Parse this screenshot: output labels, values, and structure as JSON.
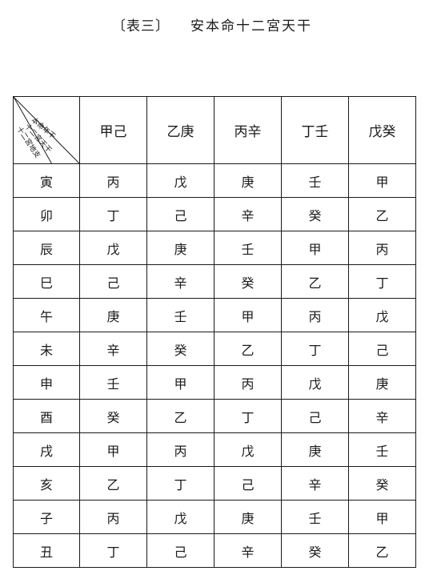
{
  "title": {
    "label": "〔表三〕",
    "text": "安本命十二宮天干"
  },
  "corner": {
    "top_label": "本命年干",
    "mid_label": "十二宮天干",
    "bottom_label": "十二宮地支"
  },
  "columns": [
    "甲己",
    "乙庚",
    "丙辛",
    "丁壬",
    "戊癸"
  ],
  "rows": [
    {
      "branch": "寅",
      "cells": [
        "丙",
        "戊",
        "庚",
        "壬",
        "甲"
      ]
    },
    {
      "branch": "卯",
      "cells": [
        "丁",
        "己",
        "辛",
        "癸",
        "乙"
      ]
    },
    {
      "branch": "辰",
      "cells": [
        "戊",
        "庚",
        "壬",
        "甲",
        "丙"
      ]
    },
    {
      "branch": "巳",
      "cells": [
        "己",
        "辛",
        "癸",
        "乙",
        "丁"
      ]
    },
    {
      "branch": "午",
      "cells": [
        "庚",
        "壬",
        "甲",
        "丙",
        "戊"
      ]
    },
    {
      "branch": "未",
      "cells": [
        "辛",
        "癸",
        "乙",
        "丁",
        "己"
      ]
    },
    {
      "branch": "申",
      "cells": [
        "壬",
        "甲",
        "丙",
        "戊",
        "庚"
      ]
    },
    {
      "branch": "酉",
      "cells": [
        "癸",
        "乙",
        "丁",
        "己",
        "辛"
      ]
    },
    {
      "branch": "戌",
      "cells": [
        "甲",
        "丙",
        "戊",
        "庚",
        "壬"
      ]
    },
    {
      "branch": "亥",
      "cells": [
        "乙",
        "丁",
        "己",
        "辛",
        "癸"
      ]
    },
    {
      "branch": "子",
      "cells": [
        "丙",
        "戊",
        "庚",
        "壬",
        "甲"
      ]
    },
    {
      "branch": "丑",
      "cells": [
        "丁",
        "己",
        "辛",
        "癸",
        "乙"
      ]
    }
  ]
}
